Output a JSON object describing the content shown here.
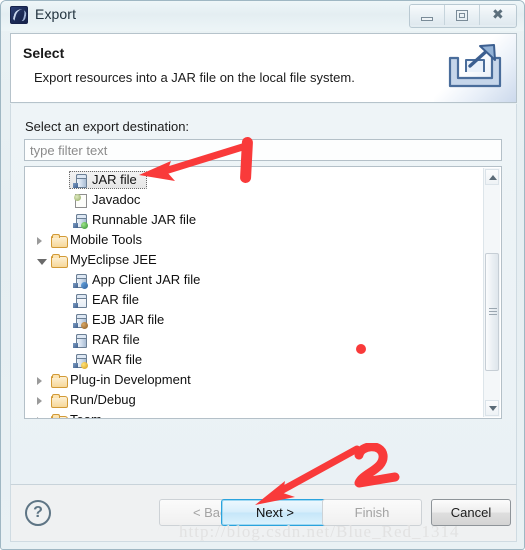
{
  "window": {
    "title": "Export",
    "app_icon": "myeclipse-icon",
    "controls": [
      {
        "name": "minimize-button",
        "glyph": "minimize-icon"
      },
      {
        "name": "maximize-button",
        "glyph": "maximize-icon"
      },
      {
        "name": "close-button",
        "glyph": "close-icon"
      }
    ]
  },
  "header": {
    "title": "Select",
    "description": "Export resources into a JAR file on the local file system.",
    "banner_icon": "export-arrow-icon"
  },
  "body": {
    "field_label": "Select an export destination:",
    "filter": {
      "value": "",
      "placeholder": "type filter text"
    },
    "tree": [
      {
        "label": "JAR file",
        "indent": 2,
        "icon": "jar-file-icon",
        "twisty": "none",
        "selected": true
      },
      {
        "label": "Javadoc",
        "indent": 2,
        "icon": "javadoc-icon",
        "twisty": "none",
        "selected": false
      },
      {
        "label": "Runnable JAR file",
        "indent": 2,
        "icon": "runnable-jar-icon",
        "twisty": "none",
        "selected": false
      },
      {
        "label": "Mobile Tools",
        "indent": 1,
        "icon": "folder-icon",
        "twisty": "collapsed",
        "selected": false
      },
      {
        "label": "MyEclipse JEE",
        "indent": 1,
        "icon": "folder-icon",
        "twisty": "expanded",
        "selected": false
      },
      {
        "label": "App Client JAR file",
        "indent": 2,
        "icon": "app-client-jar-icon",
        "twisty": "none",
        "selected": false
      },
      {
        "label": "EAR file",
        "indent": 2,
        "icon": "ear-file-icon",
        "twisty": "none",
        "selected": false
      },
      {
        "label": "EJB JAR file",
        "indent": 2,
        "icon": "ejb-jar-icon",
        "twisty": "none",
        "selected": false
      },
      {
        "label": "RAR file",
        "indent": 2,
        "icon": "rar-file-icon",
        "twisty": "none",
        "selected": false
      },
      {
        "label": "WAR file",
        "indent": 2,
        "icon": "war-file-icon",
        "twisty": "none",
        "selected": false
      },
      {
        "label": "Plug-in Development",
        "indent": 1,
        "icon": "folder-icon",
        "twisty": "collapsed",
        "selected": false
      },
      {
        "label": "Run/Debug",
        "indent": 1,
        "icon": "folder-icon",
        "twisty": "collapsed",
        "selected": false
      },
      {
        "label": "Team",
        "indent": 1,
        "icon": "folder-icon",
        "twisty": "collapsed",
        "selected": false
      }
    ],
    "scrollbar": {
      "up_arrow": "scroll-up-icon",
      "down_arrow": "scroll-down-icon"
    }
  },
  "footer": {
    "help_label": "?",
    "buttons": [
      {
        "name": "back-button",
        "label": "< Back",
        "state": "disabled"
      },
      {
        "name": "next-button",
        "label": "Next >",
        "state": "default"
      },
      {
        "name": "finish-button",
        "label": "Finish",
        "state": "disabled"
      },
      {
        "name": "cancel-button",
        "label": "Cancel",
        "state": "enabled"
      }
    ]
  },
  "watermark": "http://blog.csdn.net/Blue_Red_1314",
  "annotations": {
    "step_one": "1",
    "step_two": "2",
    "accent_color": "#f93a3a"
  }
}
